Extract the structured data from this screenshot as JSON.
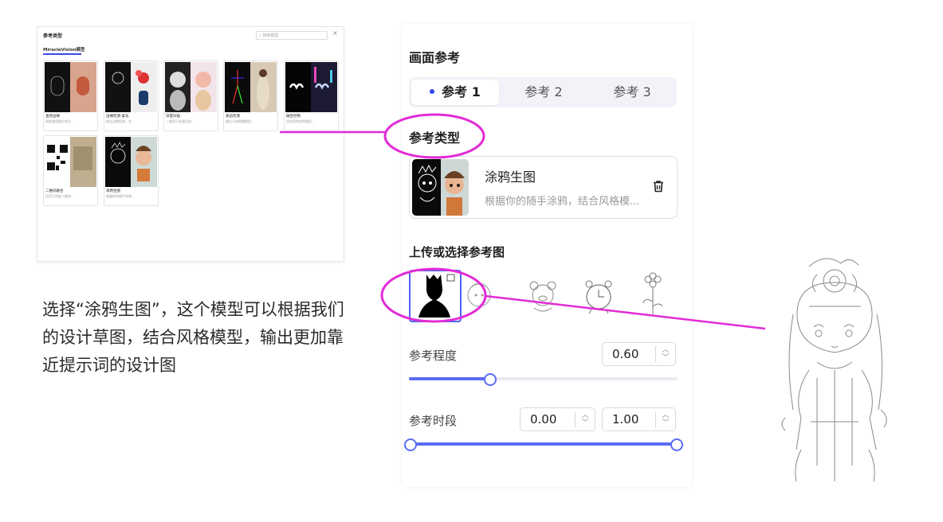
{
  "modal": {
    "title": "参考类型",
    "search_placeholder": "搜索模型",
    "close": "×",
    "tab": "MiracleVision模型",
    "cards": [
      {
        "name": "查找边缘",
        "desc": "帮助查找图片的主..."
      },
      {
        "name": "边缘检测-柔化",
        "desc": "相比边缘检测，它..."
      },
      {
        "name": "深度扫描",
        "desc": "一般用于处理比较..."
      },
      {
        "name": "姿态检测",
        "desc": "通过人体骨骼模型..."
      },
      {
        "name": "融合控制",
        "desc": "适合用特定的图形..."
      },
      {
        "name": "二维码融合",
        "desc": "适用于特定二维码..."
      },
      {
        "name": "涂鸦生图",
        "desc": "根据你的随手涂鸦..."
      }
    ]
  },
  "caption": "选择“涂鸦生图”，这个模型可以根据我们的设计草图，结合风格模型，输出更加靠近提示词的设计图",
  "panel": {
    "title": "画面参考",
    "tabs": [
      "参考 1",
      "参考 2",
      "参考 3"
    ],
    "active_tab": 0,
    "ref_type_title": "参考类型",
    "model_name": "涂鸦生图",
    "model_desc": "根据你的随手涂鸦，结合风格模...",
    "upload_title": "上传或选择参考图",
    "strength_label": "参考程度",
    "strength_value": "0.60",
    "strength_fraction": 0.3,
    "period_label": "参考时段",
    "period_start": "0.00",
    "period_end": "1.00"
  },
  "colors": {
    "accent": "#5b6cf3",
    "highlight": "#e22bd6"
  }
}
